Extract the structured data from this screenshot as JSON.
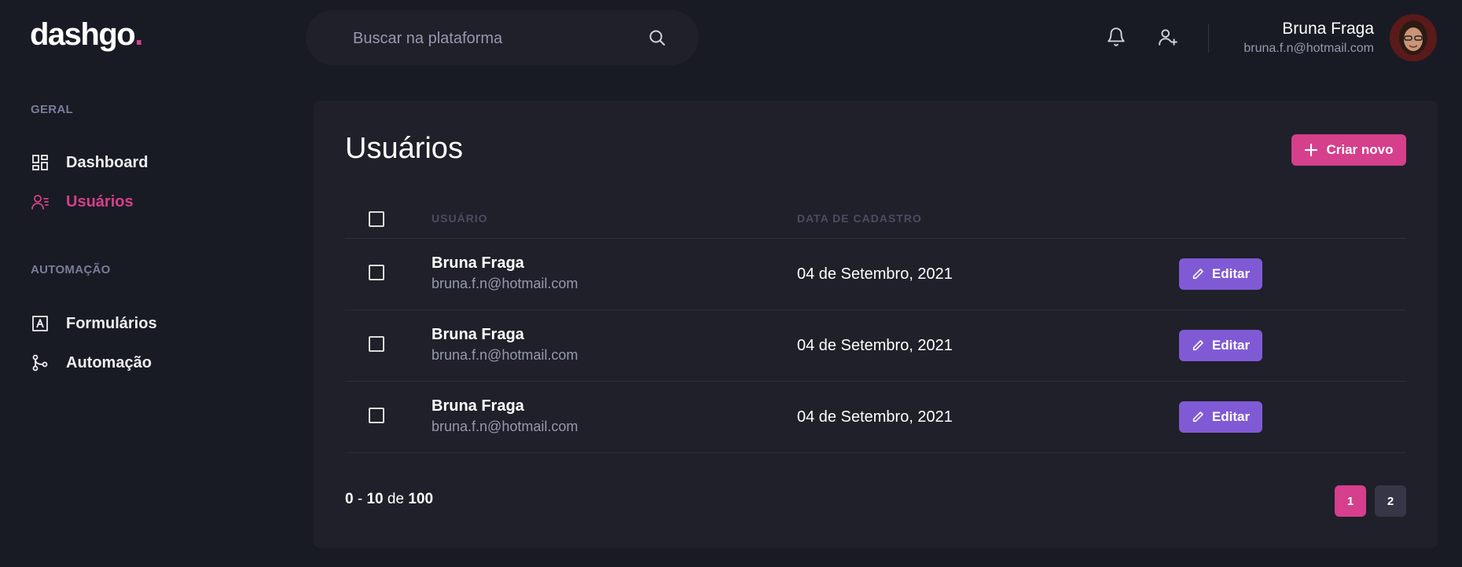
{
  "header": {
    "logo_text": "dashgo",
    "logo_dot": ".",
    "search_placeholder": "Buscar na plataforma",
    "user_name": "Bruna Fraga",
    "user_email": "bruna.f.n@hotmail.com"
  },
  "sidebar": {
    "sections": [
      {
        "title": "GERAL",
        "items": [
          {
            "label": "Dashboard",
            "icon": "dashboard-icon",
            "active": false
          },
          {
            "label": "Usuários",
            "icon": "users-icon",
            "active": true
          }
        ]
      },
      {
        "title": "AUTOMAÇÃO",
        "items": [
          {
            "label": "Formulários",
            "icon": "form-icon",
            "active": false
          },
          {
            "label": "Automação",
            "icon": "git-branch-icon",
            "active": false
          }
        ]
      }
    ]
  },
  "main": {
    "title": "Usuários",
    "create_label": "Criar novo",
    "columns": [
      "USUÁRIO",
      "DATA DE CADASTRO"
    ],
    "rows": [
      {
        "name": "Bruna Fraga",
        "email": "bruna.f.n@hotmail.com",
        "date": "04 de Setembro, 2021",
        "action": "Editar"
      },
      {
        "name": "Bruna Fraga",
        "email": "bruna.f.n@hotmail.com",
        "date": "04 de Setembro, 2021",
        "action": "Editar"
      },
      {
        "name": "Bruna Fraga",
        "email": "bruna.f.n@hotmail.com",
        "date": "04 de Setembro, 2021",
        "action": "Editar"
      }
    ],
    "pagination": {
      "from": "0",
      "separator": " - ",
      "to": "10",
      "of_label": " de ",
      "total": "100",
      "pages": [
        "1",
        "2"
      ],
      "current": "1"
    }
  },
  "colors": {
    "background": "#181b23",
    "panel": "#1f2029",
    "accent_pink": "#d53f8c",
    "accent_purple": "#805ad5",
    "muted": "#9699b0"
  }
}
